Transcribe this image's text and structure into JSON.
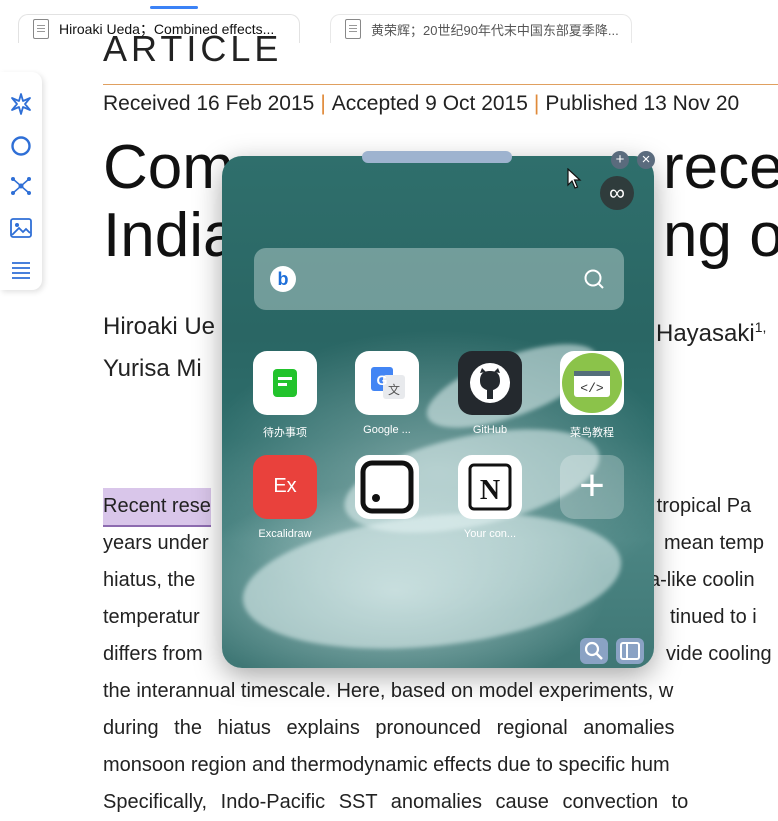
{
  "tabs": [
    {
      "label": "Hiroaki Ueda；Combined effects..."
    },
    {
      "label": "黄荣辉；20世纪90年代末中国东部夏季降..."
    }
  ],
  "article": {
    "section": "ARTICLE",
    "received": "Received 16 Feb 2015",
    "accepted": "Accepted 9 Oct 2015",
    "published": "Published 13 Nov 20",
    "title_line1_left": "Com",
    "title_line1_right": "rece",
    "title_line2_left": "India",
    "title_line2_right": "ng or",
    "authors_line1_left": "Hiroaki Ue",
    "authors_line1_right": "Hayasaki",
    "authors_line1_sup": "1,",
    "authors_line2_left": "Yurisa Mi",
    "abstract": [
      {
        "left": "Recent rese",
        "right": "e tropical Pa"
      },
      {
        "left": "years under",
        "right": "mean temp"
      },
      {
        "left": "hiatus, the",
        "right": "a-like coolin"
      },
      {
        "left": "temperatur",
        "right": "tinued to i"
      },
      {
        "left": "differs from",
        "right": "vide cooling"
      },
      {
        "full": "the interannual timescale. Here, based on model experiments, w"
      },
      {
        "full": "during the hiatus explains pronounced regional anomalies"
      },
      {
        "full": "monsoon region and thermodynamic effects due to specific hum"
      },
      {
        "full": "Specifically, Indo-Pacific SST anomalies cause convection to"
      }
    ]
  },
  "widget": {
    "infinity": "∞",
    "plus": "+",
    "close": "×",
    "apps": [
      {
        "label": "待办事项",
        "icon": "todo-icon",
        "color": "#22c32c"
      },
      {
        "label": "Google ...",
        "icon": "google-translate-icon",
        "color": "#4285f4"
      },
      {
        "label": "GitHub",
        "icon": "github-icon",
        "color": "#24292e"
      },
      {
        "label": "菜鸟教程",
        "icon": "code-icon",
        "color": "#8bc34a"
      },
      {
        "label": "Excalidraw",
        "icon": "excalidraw-icon",
        "color": "#e9413c",
        "glyph": "Ex"
      },
      {
        "label": "",
        "icon": "dice-icon",
        "color": "#111111"
      },
      {
        "label": "Your con...",
        "icon": "notion-icon",
        "color": "#111111",
        "glyph": "N"
      },
      {
        "label": "",
        "icon": "add-icon",
        "color": "#ffffff",
        "glyph": "+"
      }
    ]
  }
}
